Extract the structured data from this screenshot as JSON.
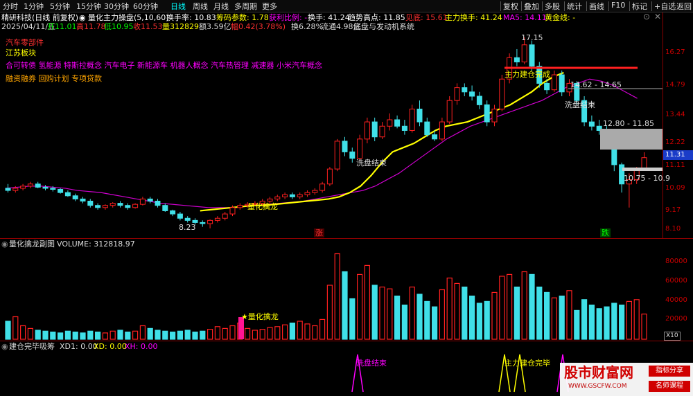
{
  "topbar": {
    "periods": [
      "分时",
      "1分钟",
      "5分钟",
      "15分钟",
      "30分钟",
      "60分钟",
      "日线",
      "周线",
      "月线",
      "多周期",
      "更多"
    ],
    "active_period": "日线",
    "tools": [
      "复权",
      "叠加",
      "多股",
      "统计",
      "画线",
      "F10",
      "标记",
      "+自选",
      "返回"
    ]
  },
  "info": {
    "stock_name": "精研科技(日线 前复权)",
    "indicator_name": "量化主力操盘(5,10,60)",
    "turnover_label": "换手率: 10.83",
    "chip_label": "筹码参数: 1.78",
    "profit_label": "获利比例: -",
    "hand_label": "换手: 41.24",
    "trend_high": "趋势高点: 11.85",
    "peak_label": "见底: 15.61",
    "main_hand": "主力换手: 41.24",
    "ma5_label": "MA5: 14.11",
    "golden_line": "黄金线: -"
  },
  "quote": {
    "date": "2025/04/11/五",
    "open": "开11.01",
    "high": "高11.78",
    "low": "低10.95",
    "close": "收11.53",
    "volume": "量312829",
    "amount": "额3.59亿",
    "change": "幅0.42(3.78%)",
    "hand": "换6.28%",
    "float": "流通4.98亿",
    "concept": "底盘与发动机系统"
  },
  "tags": {
    "sector1": "汽车零部件",
    "sector2": "江苏板块",
    "concepts": "合可转债 氢能源 特斯拉概念 汽车电子 新能源车 机器人概念 汽车热管理 减速器 小米汽车概念",
    "misc": "融资融券 回购计划 专项贷款"
  },
  "price_axis": [
    "16.27",
    "14.79",
    "13.44",
    "12.22",
    "11.11",
    "10.09",
    "9.17",
    "8.10"
  ],
  "current_price": "11.31",
  "annotations": {
    "high_mark": "17.15",
    "low_mark": "8.23",
    "range1": "14.62 - 14.65",
    "range2": "12.80 - 11.85",
    "range3": "10.75 - 10.9",
    "wash_end1": "洗盘结束",
    "wash_end2": "洗盘结束",
    "quant_dragon": "量化擒龙",
    "main_done": "主力建仓完成",
    "rise": "涨",
    "fall": "跌"
  },
  "volume_panel": {
    "title": "量化擒龙副图",
    "volume_label": "VOLUME: 312818.97",
    "axis": [
      "80000",
      "60000",
      "40000",
      "20000"
    ],
    "unit": "X10",
    "marker": "★量化擒龙"
  },
  "bottom_panel": {
    "title": "建仓完毕吸筹",
    "xd1": "XD1: 0.00",
    "xd": "XD: 0.00",
    "xh": "XH: 0.00",
    "label1": "洗盘结束",
    "label2": "主力建仓完毕"
  },
  "watermark": {
    "site": "股市财富网",
    "url": "WWW.GSCFW.COM",
    "btn1": "指标分享",
    "btn2": "名师课程"
  },
  "chart_data": {
    "type": "candlestick",
    "candles": [
      [
        10.1,
        10.0,
        10.3,
        9.9
      ],
      [
        10.0,
        10.1,
        10.2,
        9.9
      ],
      [
        10.1,
        10.2,
        10.3,
        10.0
      ],
      [
        10.2,
        10.3,
        10.4,
        10.1
      ],
      [
        10.3,
        10.15,
        10.4,
        10.1
      ],
      [
        10.15,
        10.1,
        10.25,
        10.0
      ],
      [
        10.1,
        10.05,
        10.2,
        9.95
      ],
      [
        10.05,
        9.9,
        10.1,
        9.85
      ],
      [
        9.9,
        9.75,
        10.0,
        9.7
      ],
      [
        9.75,
        9.6,
        9.85,
        9.5
      ],
      [
        9.6,
        9.5,
        9.7,
        9.4
      ],
      [
        9.5,
        9.3,
        9.6,
        9.2
      ],
      [
        9.3,
        9.2,
        9.4,
        9.1
      ],
      [
        9.2,
        9.3,
        9.35,
        9.1
      ],
      [
        9.3,
        9.4,
        9.45,
        9.2
      ],
      [
        9.4,
        9.3,
        9.5,
        9.2
      ],
      [
        9.3,
        9.2,
        9.4,
        9.1
      ],
      [
        9.2,
        9.35,
        9.4,
        9.15
      ],
      [
        9.35,
        9.6,
        9.7,
        9.3
      ],
      [
        9.6,
        9.5,
        9.7,
        9.4
      ],
      [
        9.5,
        9.3,
        9.6,
        9.2
      ],
      [
        9.3,
        9.05,
        9.4,
        9.0
      ],
      [
        9.05,
        8.9,
        9.1,
        8.8
      ],
      [
        8.9,
        8.7,
        9.0,
        8.6
      ],
      [
        8.7,
        8.6,
        8.8,
        8.5
      ],
      [
        8.6,
        8.5,
        8.7,
        8.4
      ],
      [
        8.5,
        8.45,
        8.6,
        8.3
      ],
      [
        8.45,
        8.6,
        8.65,
        8.23
      ],
      [
        8.6,
        8.7,
        8.8,
        8.5
      ],
      [
        8.7,
        8.9,
        9.0,
        8.6
      ],
      [
        8.9,
        9.2,
        9.3,
        8.8
      ],
      [
        9.2,
        9.3,
        9.4,
        9.1
      ],
      [
        9.3,
        9.35,
        9.45,
        9.2
      ],
      [
        9.35,
        9.4,
        9.5,
        9.3
      ],
      [
        9.4,
        9.5,
        9.6,
        9.3
      ],
      [
        9.5,
        9.6,
        9.7,
        9.4
      ],
      [
        9.6,
        9.7,
        9.8,
        9.5
      ],
      [
        9.7,
        9.8,
        9.9,
        9.6
      ],
      [
        9.8,
        9.7,
        9.9,
        9.6
      ],
      [
        9.7,
        9.8,
        9.9,
        9.6
      ],
      [
        9.8,
        9.9,
        10.0,
        9.7
      ],
      [
        9.9,
        10.0,
        10.1,
        9.8
      ],
      [
        10.0,
        10.3,
        10.4,
        9.9
      ],
      [
        10.3,
        11.0,
        11.1,
        10.2
      ],
      [
        11.0,
        12.3,
        12.4,
        10.9
      ],
      [
        12.3,
        11.8,
        12.5,
        11.6
      ],
      [
        11.8,
        11.5,
        12.0,
        11.3
      ],
      [
        11.5,
        12.4,
        12.6,
        11.4
      ],
      [
        12.4,
        13.2,
        13.4,
        12.2
      ],
      [
        13.2,
        12.5,
        13.4,
        12.3
      ],
      [
        12.5,
        13.0,
        13.2,
        12.4
      ],
      [
        13.0,
        13.3,
        13.6,
        12.8
      ],
      [
        13.3,
        13.0,
        13.5,
        12.9
      ],
      [
        13.0,
        12.8,
        13.3,
        12.6
      ],
      [
        12.8,
        13.8,
        14.0,
        12.7
      ],
      [
        13.8,
        13.2,
        14.2,
        13.0
      ],
      [
        13.2,
        12.6,
        13.4,
        12.5
      ],
      [
        12.6,
        12.4,
        12.8,
        12.3
      ],
      [
        12.4,
        13.2,
        13.4,
        12.3
      ],
      [
        13.2,
        14.2,
        14.4,
        13.1
      ],
      [
        14.2,
        14.8,
        15.0,
        14.0
      ],
      [
        14.8,
        14.6,
        15.0,
        14.4
      ],
      [
        14.6,
        14.4,
        14.9,
        14.2
      ],
      [
        14.4,
        14.0,
        14.6,
        13.8
      ],
      [
        14.0,
        13.2,
        14.2,
        13.0
      ],
      [
        13.2,
        13.8,
        14.0,
        13.0
      ],
      [
        13.8,
        15.2,
        15.4,
        13.7
      ],
      [
        15.2,
        16.2,
        16.4,
        15.0
      ],
      [
        16.2,
        16.0,
        16.6,
        15.8
      ],
      [
        16.0,
        16.8,
        17.15,
        15.9
      ],
      [
        16.8,
        15.8,
        17.0,
        15.6
      ],
      [
        15.8,
        15.0,
        16.0,
        14.8
      ],
      [
        15.0,
        14.7,
        15.2,
        14.5
      ],
      [
        14.7,
        15.4,
        15.6,
        14.6
      ],
      [
        15.4,
        14.6,
        15.6,
        14.4
      ],
      [
        14.6,
        15.0,
        15.2,
        14.4
      ],
      [
        15.0,
        14.2,
        15.1,
        14.0
      ],
      [
        14.2,
        13.2,
        14.4,
        13.0
      ],
      [
        13.2,
        13.0,
        13.5,
        12.8
      ],
      [
        13.0,
        12.8,
        13.3,
        12.6
      ],
      [
        12.8,
        12.6,
        13.0,
        12.3
      ],
      [
        12.6,
        11.2,
        12.8,
        10.9
      ],
      [
        11.2,
        10.3,
        11.3,
        9.9
      ],
      [
        10.3,
        10.5,
        10.8,
        9.2
      ],
      [
        10.5,
        11.0,
        11.1,
        10.3
      ],
      [
        11.01,
        11.53,
        11.78,
        10.95
      ]
    ],
    "ma_yellow": [
      9.05,
      9.1,
      9.15,
      9.2,
      9.25,
      9.3,
      9.3,
      9.35,
      9.4,
      9.45,
      9.5,
      9.55,
      9.6,
      9.7,
      9.9,
      10.2,
      10.7,
      11.3,
      11.8,
      12.0,
      12.2,
      12.5,
      12.8,
      13.0,
      13.1,
      13.2,
      13.4,
      13.6,
      13.8,
      14.0,
      14.3,
      14.6,
      15.0,
      15.3,
      15.5
    ],
    "ma_purple": [
      10.1,
      10.15,
      10.2,
      10.2,
      10.15,
      10.1,
      10.0,
      9.95,
      9.9,
      9.8,
      9.7,
      9.6,
      9.5,
      9.4,
      9.35,
      9.3,
      9.25,
      9.2,
      9.2,
      9.2,
      9.25,
      9.3,
      9.35,
      9.4,
      9.45,
      9.5,
      9.6,
      9.7,
      9.8,
      9.9,
      10.0,
      10.2,
      10.5,
      10.8,
      11.2,
      11.6,
      12.0,
      12.4,
      12.7,
      13.0,
      13.2,
      13.4,
      13.6,
      13.8,
      14.0,
      14.2,
      14.5,
      14.8,
      15.0,
      15.2,
      15.1,
      14.9,
      14.6,
      14.3
    ],
    "volumes": [
      20000,
      25000,
      15000,
      12000,
      10000,
      9000,
      8000,
      7000,
      9000,
      8000,
      7000,
      9000,
      8000,
      7000,
      9000,
      10000,
      8000,
      9000,
      15000,
      12000,
      10000,
      9000,
      8000,
      9000,
      10000,
      8000,
      9000,
      11000,
      14000,
      12000,
      15000,
      18000,
      12000,
      10000,
      11000,
      13000,
      14000,
      16000,
      18000,
      20000,
      17000,
      15000,
      22000,
      60000,
      95000,
      75000,
      45000,
      72000,
      82000,
      60000,
      58000,
      56000,
      48000,
      38000,
      58000,
      50000,
      42000,
      36000,
      55000,
      68000,
      62000,
      58000,
      48000,
      40000,
      42000,
      52000,
      70000,
      72000,
      58000,
      75000,
      72000,
      58000,
      52000,
      46000,
      48000,
      54000,
      32000,
      44000,
      38000,
      34000,
      36000,
      40000,
      38000,
      42000,
      44000,
      28000
    ]
  }
}
